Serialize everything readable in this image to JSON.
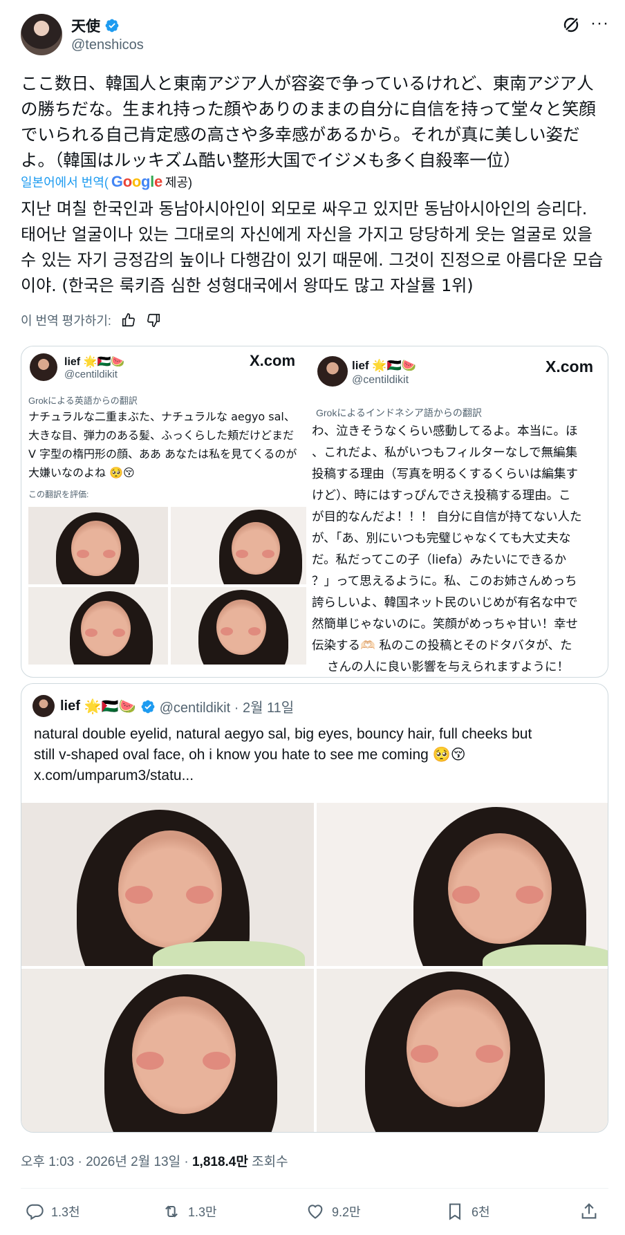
{
  "author": {
    "name": "天使",
    "handle": "@tenshicos"
  },
  "tweet": {
    "text_ja": "ここ数日、韓国人と東南アジア人が容姿で争っているけれど、東南アジア人の勝ちだな。生まれ持った顔やありのままの自分に自信を持って堂々と笑顔でいられる自己肯定感の高さや多幸感があるから。それが真に美しい姿だよ。（韓国はルッキズム酷い整形大国でイジメも多く自殺率一位）",
    "translated_from": "일본어에서 번역(",
    "google": "Google",
    "provided": " 제공)",
    "text_ko": "지난 며칠 한국인과 동남아시아인이 외모로 싸우고 있지만 동남아시아인의 승리다. 태어난 얼굴이나 있는 그대로의 자신에게 자신을 가지고 당당하게 웃는 얼굴로 있을 수 있는 자기 긍정감의 높이나 다행감이 있기 때문에. 그것이 진정으로 아름다운 모습이야. (한국은 룩키즘 심한 성형대국에서 왕따도 많고 자살률 1위)",
    "rate_label": "이 번역 평가하기:"
  },
  "card1": {
    "left": {
      "name": "lief 🌟🇵🇸🍉",
      "handle": "@centildikit",
      "xcom": "X.com",
      "grok_note": "Grokによる英語からの翻訳",
      "text": "ナチュラルな二重まぶた、ナチュラルな aegyo sal、大きな目、弾力のある髪、ふっくらした頬だけどまだ V 字型の楕円形の顔、ああ あなたは私を見てくるのが大嫌いなのよね 🥺😚",
      "rate_label": "この翻訳を評価:"
    },
    "right": {
      "name": "lief 🌟🇵🇸🍉",
      "handle": "@centildikit",
      "xcom": "X.com",
      "grok_note": "Grokによるインドネシア語からの翻訳",
      "lines": [
        "わ、泣きそうなくらい感動してるよ。本当に。ほ",
        "、これだよ、私がいつもフィルターなしで無編集",
        "投稿する理由（写真を明るくするくらいは編集す",
        "けど）、時にはすっぴんでさえ投稿する理由。こ",
        "が目的なんだよ！！！ 自分に自信が持てない人た",
        "が、「あ、別にいつも完璧じゃなくても大丈夫な",
        "だ。私だってこの子（liefa）みたいにできるか",
        "？」って思えるように。私、このお姉さんめっち",
        "誇らしいよ、韓国ネット民のいじめが有名な中で",
        "然簡単じゃないのに。笑顔がめっちゃ甘い！幸せ",
        "伝染する🫶🏻 私のこの投稿とそのドタバタが、た",
        "さんの人に良い影響を与えられますように！"
      ]
    }
  },
  "card2": {
    "name": "lief",
    "emojis": "🌟🇵🇸🍉",
    "handle_date": "@centildikit · 2월 11일",
    "text_line1": "natural double eyelid, natural aegyo sal, big eyes, bouncy hair, full cheeks but",
    "text_line2": "still v-shaped oval face, oh i know you hate to see me coming 🥺😚",
    "link": "x.com/umparum3/statu..."
  },
  "meta": {
    "time_date": "오후 1:03 · 2026년 2월 13일 · ",
    "views": "1,818.4만",
    "views_label": " 조회수"
  },
  "actions": {
    "replies": "1.3천",
    "reposts": "1.3만",
    "likes": "9.2만",
    "bookmarks": "6천"
  },
  "colors": {
    "accent": "#1d9bf0",
    "text": "#0f1419",
    "muted": "#536471",
    "border": "#cfd9de"
  }
}
